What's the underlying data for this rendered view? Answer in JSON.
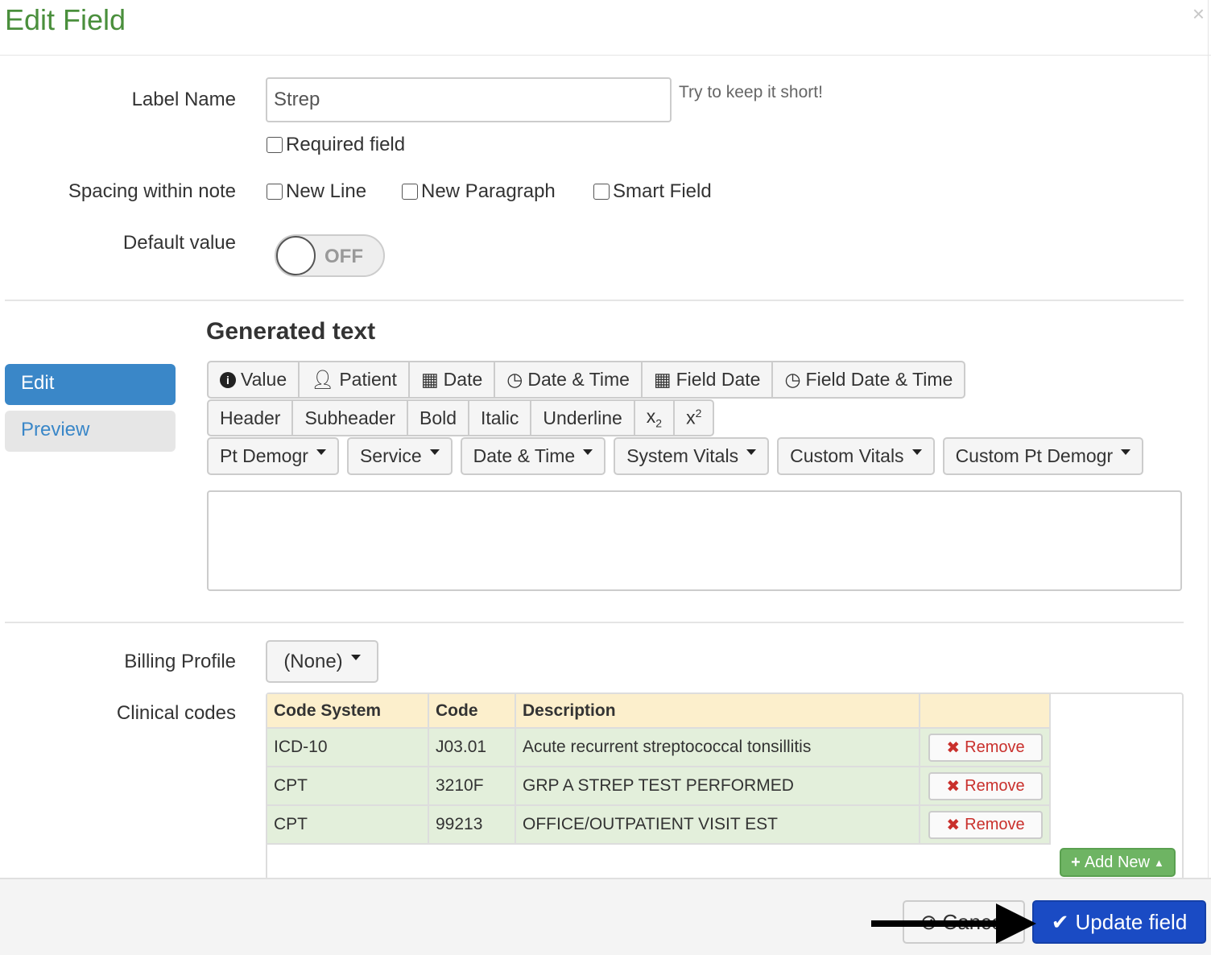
{
  "dialog": {
    "title": "Edit Field",
    "close_icon": "×"
  },
  "form": {
    "label_name": {
      "label": "Label Name",
      "value": "Strep",
      "hint": "Try to keep it short!"
    },
    "required": {
      "label": "Required field",
      "checked": false
    },
    "spacing": {
      "label": "Spacing within note",
      "options": [
        {
          "label": "New Line",
          "checked": false
        },
        {
          "label": "New Paragraph",
          "checked": false
        },
        {
          "label": "Smart Field",
          "checked": false
        }
      ]
    },
    "default_value": {
      "label": "Default value",
      "toggle": "OFF",
      "on": false
    }
  },
  "generated": {
    "heading": "Generated text",
    "tabs": [
      {
        "label": "Edit",
        "active": true
      },
      {
        "label": "Preview",
        "active": false
      }
    ],
    "toolbar_row1": [
      "Value",
      "Patient",
      "Date",
      "Date & Time",
      "Field Date",
      "Field Date & Time"
    ],
    "toolbar_row1_icons": [
      "info-icon",
      "user-icon",
      "calendar-icon",
      "clock-icon",
      "calendar-icon",
      "clock-icon"
    ],
    "toolbar_row2": [
      "Header",
      "Subheader",
      "Bold",
      "Italic",
      "Underline"
    ],
    "dropdowns": [
      "Pt Demogr",
      "Service",
      "Date & Time",
      "System Vitals",
      "Custom Vitals",
      "Custom Pt Demogr"
    ],
    "text": ""
  },
  "billing": {
    "label": "Billing Profile",
    "value": "(None)"
  },
  "codes": {
    "label": "Clinical codes",
    "columns": [
      "Code System",
      "Code",
      "Description"
    ],
    "rows": [
      {
        "system": "ICD-10",
        "code": "J03.01",
        "description": "Acute recurrent streptococcal tonsillitis"
      },
      {
        "system": "CPT",
        "code": "3210F",
        "description": "GRP A STREP TEST PERFORMED"
      },
      {
        "system": "CPT",
        "code": "99213",
        "description": "OFFICE/OUTPATIENT VISIT EST"
      }
    ],
    "remove_label": "Remove",
    "add_new_label": "Add New"
  },
  "footer": {
    "cancel_label": "Cancel",
    "update_label": "Update field"
  },
  "colors": {
    "title": "#4a8f3c",
    "primary": "#1a4bc4",
    "tab_active": "#3a87c8",
    "header_row": "#fcefcc",
    "row": "#e3efdb",
    "add_new": "#6eb463"
  }
}
